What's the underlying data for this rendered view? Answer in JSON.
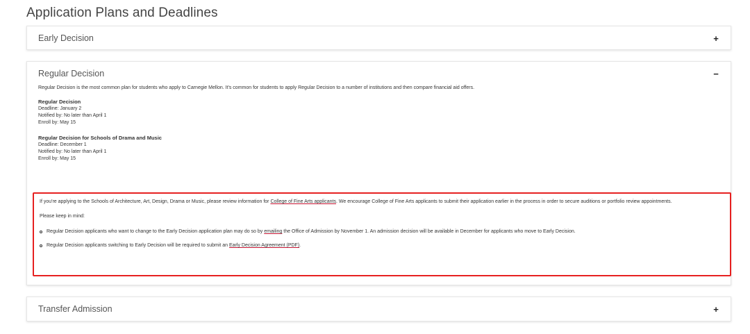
{
  "page": {
    "title": "Application Plans and Deadlines"
  },
  "panels": {
    "early_decision": {
      "title": "Early Decision",
      "toggle": "+"
    },
    "regular_decision": {
      "title": "Regular Decision",
      "toggle": "−",
      "intro": "Regular Decision is the most common plan for students who apply to Carnegie Mellon. It's common for students to apply Regular Decision to a number of institutions and then compare financial aid offers.",
      "plans": [
        {
          "title": "Regular Decision",
          "deadline": "Deadline: January 2",
          "notified": "Notified by: No later than April 1",
          "enroll": "Enroll by: May 15"
        },
        {
          "title": "Regular Decision for Schools of Drama and Music",
          "deadline": "Deadline: December 1",
          "notified": "Notified by: No later than April 1",
          "enroll": "Enroll by: May 15"
        }
      ],
      "note": {
        "p1_before": "If you're applying to the Schools of Architecture, Art, Design, Drama or Music, please review information for ",
        "p1_link": "College of Fine Arts applicants",
        "p1_after": ".  We encourage College of Fine Arts applicants to submit their application earlier in the process in order to secure auditions or portfolio review appointments.",
        "p2": "Please keep in mind:",
        "bullets": [
          {
            "before": "Regular Decision applicants who want to change to the Early Decision application plan may do so by ",
            "link": "emailing",
            "after": " the Office of Admission by November 1. An admission decision will be available in December for applicants who move to Early Decision."
          },
          {
            "before": "Regular Decision applicants switching to Early Decision will be required to submit an ",
            "link": "Early Decision Agreement (PDF)",
            "after": "."
          }
        ]
      }
    },
    "transfer_admission": {
      "title": "Transfer Admission",
      "toggle": "+"
    }
  },
  "colors": {
    "highlight_border": "#e62020",
    "link_underline": "#c41230"
  }
}
